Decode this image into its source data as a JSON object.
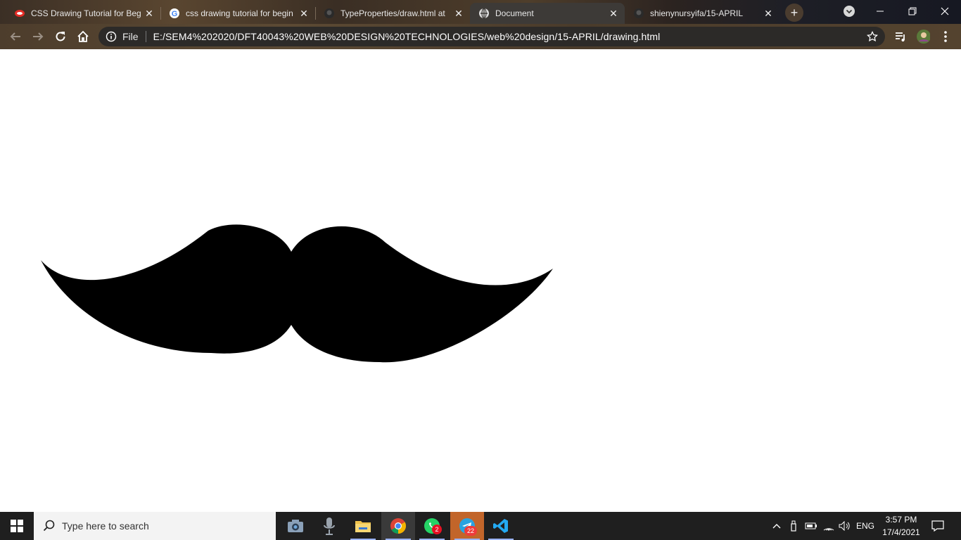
{
  "browser": {
    "tabs": [
      {
        "title": "CSS Drawing Tutorial for Beg",
        "icon": "brand-logo-icon",
        "active": false
      },
      {
        "title": "css drawing tutorial for begin",
        "icon": "google-icon",
        "active": false
      },
      {
        "title": "TypeProperties/draw.html at",
        "icon": "github-icon",
        "active": false
      },
      {
        "title": "Document",
        "icon": "globe-icon",
        "active": true
      },
      {
        "title": "shienynursyifa/15-APRIL",
        "icon": "github-icon",
        "active": false
      }
    ],
    "address": {
      "scheme_label": "File",
      "url": "E:/SEM4%202020/DFT40043%20WEB%20DESIGN%20TECHNOLOGIES/web%20design/15-APRIL/drawing.html"
    },
    "accent_colors": {
      "tab_active_bg": "#3d3a37",
      "frame": "#4d3d2c",
      "omnibox_bg": "#2c2a28"
    }
  },
  "page": {
    "drawing": "mustache",
    "fill_color": "#000000"
  },
  "taskbar": {
    "search_placeholder": "Type here to search",
    "apps": [
      {
        "name": "camera-icon"
      },
      {
        "name": "voice-recorder-icon"
      },
      {
        "name": "file-explorer-icon"
      },
      {
        "name": "chrome-icon"
      },
      {
        "name": "whatsapp-icon",
        "badge": "2"
      },
      {
        "name": "telegram-icon",
        "badge": "22"
      },
      {
        "name": "vscode-icon"
      }
    ],
    "tray": {
      "language": "ENG",
      "time": "3:57 PM",
      "date": "17/4/2021"
    }
  }
}
